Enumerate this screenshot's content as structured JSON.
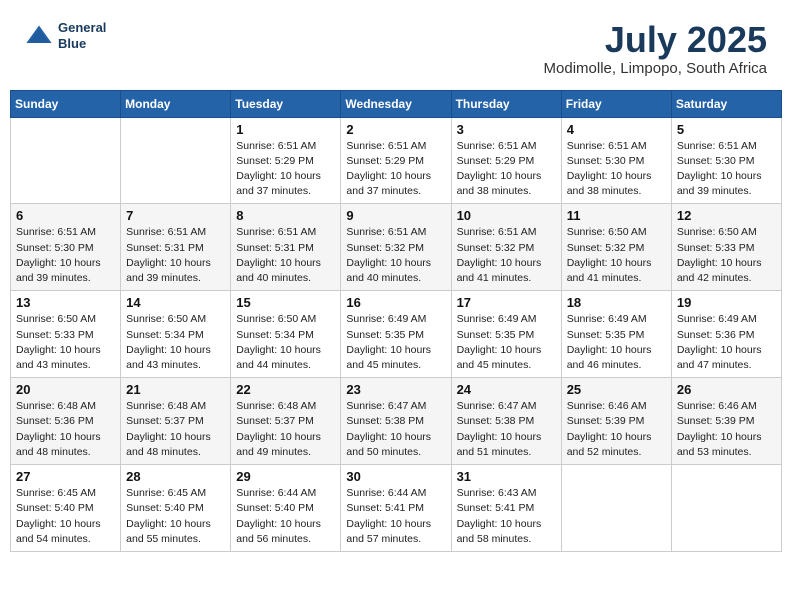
{
  "header": {
    "logo_line1": "General",
    "logo_line2": "Blue",
    "month_year": "July 2025",
    "location": "Modimolle, Limpopo, South Africa"
  },
  "weekdays": [
    "Sunday",
    "Monday",
    "Tuesday",
    "Wednesday",
    "Thursday",
    "Friday",
    "Saturday"
  ],
  "weeks": [
    [
      {
        "day": "",
        "content": ""
      },
      {
        "day": "",
        "content": ""
      },
      {
        "day": "1",
        "content": "Sunrise: 6:51 AM\nSunset: 5:29 PM\nDaylight: 10 hours and 37 minutes."
      },
      {
        "day": "2",
        "content": "Sunrise: 6:51 AM\nSunset: 5:29 PM\nDaylight: 10 hours and 37 minutes."
      },
      {
        "day": "3",
        "content": "Sunrise: 6:51 AM\nSunset: 5:29 PM\nDaylight: 10 hours and 38 minutes."
      },
      {
        "day": "4",
        "content": "Sunrise: 6:51 AM\nSunset: 5:30 PM\nDaylight: 10 hours and 38 minutes."
      },
      {
        "day": "5",
        "content": "Sunrise: 6:51 AM\nSunset: 5:30 PM\nDaylight: 10 hours and 39 minutes."
      }
    ],
    [
      {
        "day": "6",
        "content": "Sunrise: 6:51 AM\nSunset: 5:30 PM\nDaylight: 10 hours and 39 minutes."
      },
      {
        "day": "7",
        "content": "Sunrise: 6:51 AM\nSunset: 5:31 PM\nDaylight: 10 hours and 39 minutes."
      },
      {
        "day": "8",
        "content": "Sunrise: 6:51 AM\nSunset: 5:31 PM\nDaylight: 10 hours and 40 minutes."
      },
      {
        "day": "9",
        "content": "Sunrise: 6:51 AM\nSunset: 5:32 PM\nDaylight: 10 hours and 40 minutes."
      },
      {
        "day": "10",
        "content": "Sunrise: 6:51 AM\nSunset: 5:32 PM\nDaylight: 10 hours and 41 minutes."
      },
      {
        "day": "11",
        "content": "Sunrise: 6:50 AM\nSunset: 5:32 PM\nDaylight: 10 hours and 41 minutes."
      },
      {
        "day": "12",
        "content": "Sunrise: 6:50 AM\nSunset: 5:33 PM\nDaylight: 10 hours and 42 minutes."
      }
    ],
    [
      {
        "day": "13",
        "content": "Sunrise: 6:50 AM\nSunset: 5:33 PM\nDaylight: 10 hours and 43 minutes."
      },
      {
        "day": "14",
        "content": "Sunrise: 6:50 AM\nSunset: 5:34 PM\nDaylight: 10 hours and 43 minutes."
      },
      {
        "day": "15",
        "content": "Sunrise: 6:50 AM\nSunset: 5:34 PM\nDaylight: 10 hours and 44 minutes."
      },
      {
        "day": "16",
        "content": "Sunrise: 6:49 AM\nSunset: 5:35 PM\nDaylight: 10 hours and 45 minutes."
      },
      {
        "day": "17",
        "content": "Sunrise: 6:49 AM\nSunset: 5:35 PM\nDaylight: 10 hours and 45 minutes."
      },
      {
        "day": "18",
        "content": "Sunrise: 6:49 AM\nSunset: 5:35 PM\nDaylight: 10 hours and 46 minutes."
      },
      {
        "day": "19",
        "content": "Sunrise: 6:49 AM\nSunset: 5:36 PM\nDaylight: 10 hours and 47 minutes."
      }
    ],
    [
      {
        "day": "20",
        "content": "Sunrise: 6:48 AM\nSunset: 5:36 PM\nDaylight: 10 hours and 48 minutes."
      },
      {
        "day": "21",
        "content": "Sunrise: 6:48 AM\nSunset: 5:37 PM\nDaylight: 10 hours and 48 minutes."
      },
      {
        "day": "22",
        "content": "Sunrise: 6:48 AM\nSunset: 5:37 PM\nDaylight: 10 hours and 49 minutes."
      },
      {
        "day": "23",
        "content": "Sunrise: 6:47 AM\nSunset: 5:38 PM\nDaylight: 10 hours and 50 minutes."
      },
      {
        "day": "24",
        "content": "Sunrise: 6:47 AM\nSunset: 5:38 PM\nDaylight: 10 hours and 51 minutes."
      },
      {
        "day": "25",
        "content": "Sunrise: 6:46 AM\nSunset: 5:39 PM\nDaylight: 10 hours and 52 minutes."
      },
      {
        "day": "26",
        "content": "Sunrise: 6:46 AM\nSunset: 5:39 PM\nDaylight: 10 hours and 53 minutes."
      }
    ],
    [
      {
        "day": "27",
        "content": "Sunrise: 6:45 AM\nSunset: 5:40 PM\nDaylight: 10 hours and 54 minutes."
      },
      {
        "day": "28",
        "content": "Sunrise: 6:45 AM\nSunset: 5:40 PM\nDaylight: 10 hours and 55 minutes."
      },
      {
        "day": "29",
        "content": "Sunrise: 6:44 AM\nSunset: 5:40 PM\nDaylight: 10 hours and 56 minutes."
      },
      {
        "day": "30",
        "content": "Sunrise: 6:44 AM\nSunset: 5:41 PM\nDaylight: 10 hours and 57 minutes."
      },
      {
        "day": "31",
        "content": "Sunrise: 6:43 AM\nSunset: 5:41 PM\nDaylight: 10 hours and 58 minutes."
      },
      {
        "day": "",
        "content": ""
      },
      {
        "day": "",
        "content": ""
      }
    ]
  ]
}
